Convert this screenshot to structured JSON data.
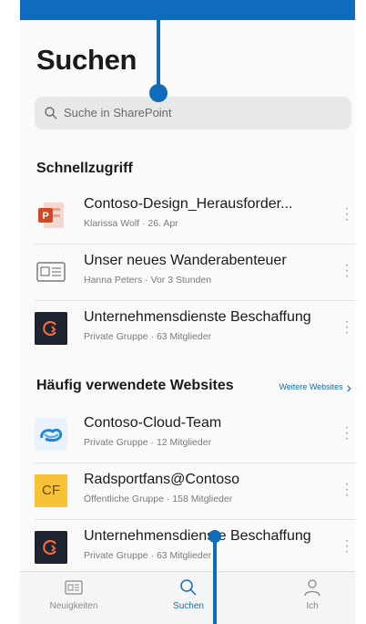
{
  "header": {
    "title": "Suchen"
  },
  "search": {
    "placeholder": "Suche in SharePoint"
  },
  "quick_access": {
    "heading": "Schnellzugriff",
    "items": [
      {
        "name": "Contoso-Design_Herausforder...",
        "subtitle": "Klarissa Wolf · 26. Apr",
        "icon": "powerpoint-icon"
      },
      {
        "name": "Unser neues Wanderabenteuer",
        "subtitle": "Hanna Peters · Vor 3 Stunden",
        "icon": "news-icon"
      },
      {
        "name": "Unternehmensdienste Beschaffung",
        "subtitle": "Private Gruppe · 63 Mitglieder",
        "icon": "group-logo-icon"
      }
    ]
  },
  "frequent_sites": {
    "heading": "Häufig verwendete Websites",
    "more_label": "Weitere Websites",
    "items": [
      {
        "name": "Contoso-Cloud-Team",
        "subtitle": "Private Gruppe · 12 Mitglieder",
        "icon": "cloud-logo-icon"
      },
      {
        "name": "Radsportfans@Contoso",
        "subtitle": "Öffentliche Gruppe · 158 Mitglieder",
        "initials": "CF"
      },
      {
        "name": "Unternehmensdienste Beschaffung",
        "subtitle": "Private Gruppe · 63 Mitglieder",
        "icon": "group-logo-icon"
      }
    ]
  },
  "tabbar": {
    "tabs": [
      {
        "label": "Neuigkeiten",
        "icon": "news-icon",
        "active": false
      },
      {
        "label": "Suchen",
        "icon": "search-icon",
        "active": true
      },
      {
        "label": "Ich",
        "icon": "person-icon",
        "active": false
      }
    ]
  },
  "colors": {
    "accent": "#0f6cbd",
    "powerpoint": "#d24726",
    "cf_tile": "#f7c235",
    "dark_tile": "#1f2530",
    "orange_logo": "#f26b3a"
  }
}
